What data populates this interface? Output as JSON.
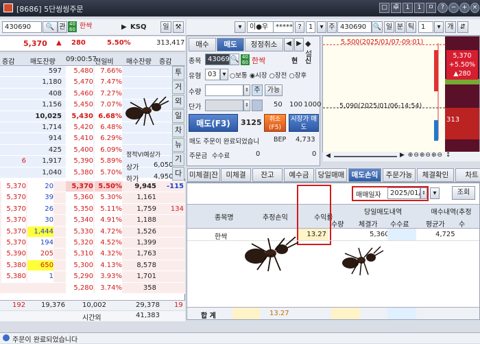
{
  "window": {
    "title": "[8686] 5단씽씽주문",
    "buttons": [
      "□",
      "卓",
      "1",
      "1",
      "ㅁ",
      "□",
      "?",
      "−",
      "+",
      "×"
    ]
  },
  "left_toolbar": {
    "code": "430690",
    "search_label": "관",
    "badge": "40 60",
    "name": "한싹",
    "ksq": "KSQ",
    "btn_one": "일"
  },
  "summary": {
    "price": "5,370",
    "arrow": "▲",
    "change": "280",
    "rate": "5.50%",
    "volume": "313,417"
  },
  "ob_header": [
    "증감",
    "매도잔량",
    "09:00:57",
    "전일비",
    "매수잔량",
    "증감"
  ],
  "sell_rows": [
    {
      "qty": "597",
      "price": "5,480",
      "rate": "7.66%"
    },
    {
      "qty": "1,180",
      "price": "5,470",
      "rate": "7.47%"
    },
    {
      "qty": "408",
      "price": "5,460",
      "rate": "7.27%"
    },
    {
      "qty": "1,156",
      "price": "5,450",
      "rate": "7.07%"
    },
    {
      "qty": "10,025",
      "price": "5,430",
      "rate": "6.68%"
    },
    {
      "qty": "1,714",
      "price": "5,420",
      "rate": "6.48%"
    },
    {
      "qty": "914",
      "price": "5,410",
      "rate": "6.29%"
    },
    {
      "qty": "425",
      "price": "5,400",
      "rate": "6.09%"
    },
    {
      "chg": "6",
      "qty": "1,917",
      "price": "5,390",
      "rate": "5.89%"
    },
    {
      "qty": "1,040",
      "price": "5,380",
      "rate": "5.70%"
    }
  ],
  "buy_rows": [
    {
      "trade": "5,370",
      "tq": "20",
      "price": "5,370",
      "rate": "5.50%",
      "qty": "9,945",
      "chg": "-115"
    },
    {
      "trade": "5,370",
      "tq": "39",
      "price": "5,360",
      "rate": "5.30%",
      "qty": "1,161"
    },
    {
      "trade": "5,370",
      "tq": "26",
      "price": "5,350",
      "rate": "5.11%",
      "qty": "1,759",
      "chg": "134"
    },
    {
      "trade": "5,370",
      "tq": "30",
      "price": "5,340",
      "rate": "4.91%",
      "qty": "1,188"
    },
    {
      "trade": "5,370",
      "tq": "1,444",
      "price": "5,330",
      "rate": "4.72%",
      "qty": "1,526"
    },
    {
      "trade": "5,370",
      "tq": "194",
      "price": "5,320",
      "rate": "4.52%",
      "qty": "1,399"
    },
    {
      "trade": "5,390",
      "tq": "205",
      "price": "5,310",
      "rate": "4.32%",
      "qty": "1,763"
    },
    {
      "trade": "5,380",
      "tq": "650",
      "price": "5,300",
      "rate": "4.13%",
      "qty": "8,578"
    },
    {
      "trade": "5,380",
      "tq": "1",
      "price": "5,290",
      "rate": "3.93%",
      "qty": "1,701"
    },
    {
      "trade": "",
      "tq": "",
      "price": "5,280",
      "rate": "3.74%",
      "qty": "358"
    }
  ],
  "ob_totals": {
    "chg_sell": "192",
    "sell_total": "19,376",
    "mid_total": "10,002",
    "buy_total": "29,378",
    "chg_buy": "19"
  },
  "after_hours": {
    "label": "시간외",
    "value": "41,383"
  },
  "static_info": {
    "label": "정적VI예상가",
    "upper_label": "상가",
    "upper_value": "6,050",
    "lower_label": "하가",
    "lower_value": "4,950"
  },
  "side_tabs": [
    "투",
    "거",
    "외",
    "일",
    "차",
    "뉴",
    "기",
    "다"
  ],
  "order_panel": {
    "tabs": [
      "매수",
      "매도",
      "정정취소"
    ],
    "code": "430690",
    "name": "한싹",
    "hyun": "현",
    "sin": "신",
    "type_label": "유형",
    "type_code": "03",
    "radios": [
      "보통",
      "시장",
      "장전",
      "장후"
    ],
    "qty_label": "수량",
    "qty_btn": "주",
    "avail_btn": "가능",
    "price_label": "단가",
    "pct_btns": [
      "50",
      "100",
      "1000"
    ],
    "sell_btn": "매도(F3)",
    "count": "3125",
    "cancel_btn": "취소(F5)",
    "market_sell_btn": "시장가 매도",
    "msg": "매도 주문이 완료되었습니",
    "bep_label": "BEP",
    "bep_value": "4,733",
    "foot": [
      "주문금",
      "수수료"
    ],
    "foot_vals": [
      "0",
      "0"
    ]
  },
  "top_right": {
    "login": "이●우",
    "pw": "*****",
    "q": "?",
    "one": "1",
    "jin": "주",
    "code": "430690",
    "btns": [
      "일",
      "분",
      "틱"
    ],
    "n": "1",
    "ge": "개"
  },
  "chart": {
    "label_high": "5,500(2025/01/07-09:01)",
    "label_low": "5,090(2025/01/06-14:54)",
    "right_price": "5,370",
    "right_rate": "+5.50%",
    "right_chg": "▲280",
    "right_low": "313"
  },
  "bottom_tabs": [
    "미체결",
    "잔고",
    "예수금",
    "당일매매",
    "매도손익",
    "주문가능",
    "체결확인",
    "차트"
  ],
  "sub_tab": "미체결|잔",
  "date_label": "매매일자",
  "date_value": "2025/01/07",
  "lookup_btn": "조회",
  "pnl_headers": {
    "name": "종목명",
    "est": "추정손익",
    "rate": "수익률",
    "sell_group": "당일매도내역",
    "qty": "수량",
    "fill": "체결가",
    "fee": "수수료",
    "buy_group": "매수내역(추정",
    "avg": "평균가",
    "count": "수"
  },
  "pnl_row": {
    "name": "한싹",
    "rate": "13.27",
    "fill": "5,360",
    "avg": "4,725"
  },
  "total": {
    "label": "합 계",
    "rate": "13.27"
  },
  "status": "주문이 완료되었습니다"
}
